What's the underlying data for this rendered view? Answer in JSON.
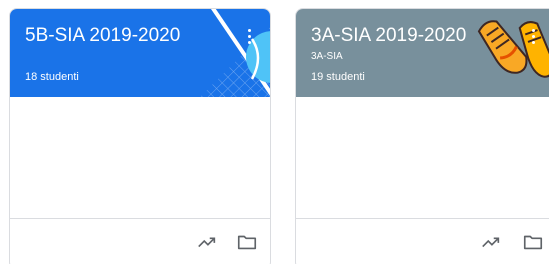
{
  "classes": [
    {
      "title": "5B-SIA 2019-2020",
      "subtitle": "",
      "students": "18 studenti",
      "header_color": "#1a73e8",
      "theme_icon": "tennis-ball-icon"
    },
    {
      "title": "3A-SIA 2019-2020",
      "subtitle": "3A-SIA",
      "students": "19 studenti",
      "header_color": "#78909c",
      "theme_icon": "sneakers-icon"
    }
  ],
  "icons": {
    "menu": "more-vert-icon",
    "progress": "trending-up-icon",
    "folder": "folder-icon"
  }
}
